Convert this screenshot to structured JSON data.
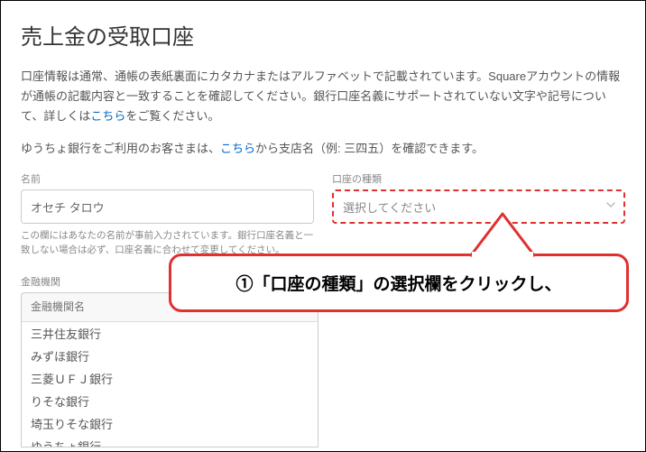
{
  "page": {
    "title": "売上金の受取口座"
  },
  "desc": {
    "p1_a": "口座情報は通常、通帳の表紙裏面にカタカナまたはアルファベットで記載されています。Squareアカウントの情報が通帳の記載内容と一致することを確認してください。銀行口座名義にサポートされていない文字や記号について、詳しくは",
    "p1_link": "こちら",
    "p1_b": "をご覧ください。",
    "p2_a": "ゆうちょ銀行をご利用のお客さまは、",
    "p2_link": "こちら",
    "p2_b": "から支店名（例: 三四五）を確認できます。"
  },
  "fields": {
    "name": {
      "label": "名前",
      "value": "オセチ タロウ",
      "helper": "この欄にはあなたの名前が事前入力されています。銀行口座名義と一致しない場合は必ず、口座名義に合わせて変更してください。"
    },
    "account_type": {
      "label": "口座の種類",
      "placeholder": "選択してください"
    },
    "bank": {
      "label": "金融機関",
      "search_placeholder": "金融機関名",
      "options": [
        "三井住友銀行",
        "みずほ銀行",
        "三菱ＵＦＪ銀行",
        "りそな銀行",
        "埼玉りそな銀行",
        "ゆうちょ銀行"
      ]
    }
  },
  "callout": {
    "text": "①「口座の種類」の選択欄をクリックし、"
  },
  "colors": {
    "accent_red": "#e03030",
    "link_blue": "#0066cc"
  }
}
